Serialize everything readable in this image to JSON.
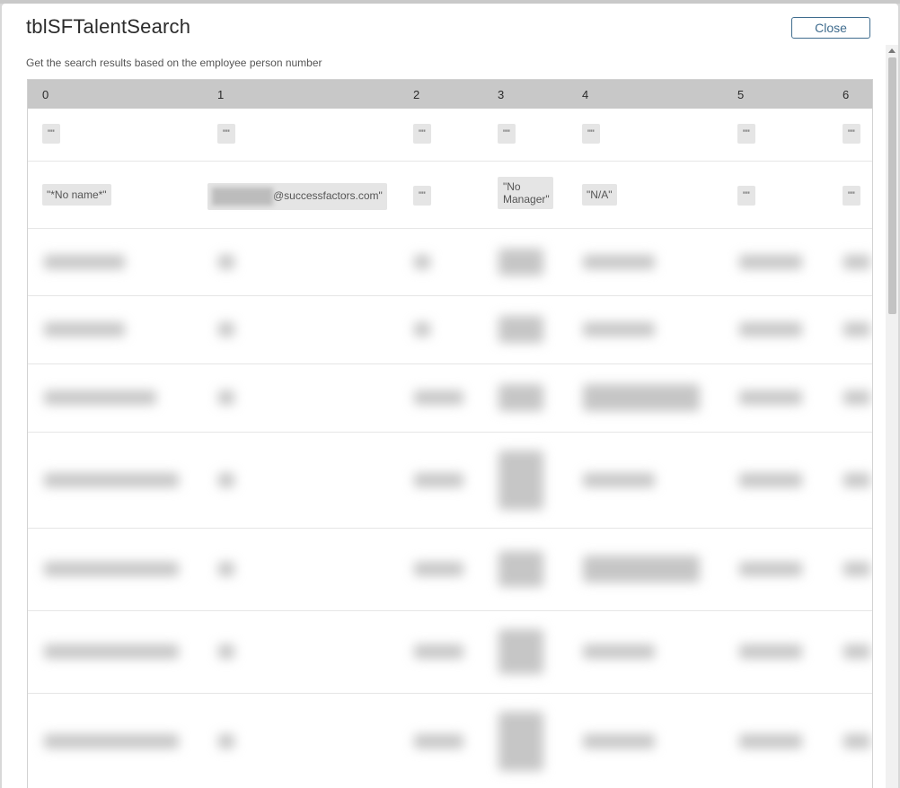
{
  "dialog": {
    "title": "tblSFTalentSearch",
    "close_label": "Close",
    "description": "Get the search results based on the employee person number"
  },
  "table": {
    "columns": [
      "0",
      "1",
      "2",
      "3",
      "4",
      "5",
      "6"
    ],
    "rows": [
      [
        "\"\"",
        "\"\"",
        "\"\"",
        "\"\"",
        "\"\"",
        "\"\"",
        "\"\""
      ],
      [
        "\"*No name*\"",
        "@successfactors.com\"",
        "\"\"",
        "\"No Manager\"",
        "\"N/A\"",
        "\"\"",
        "\"\""
      ]
    ]
  }
}
